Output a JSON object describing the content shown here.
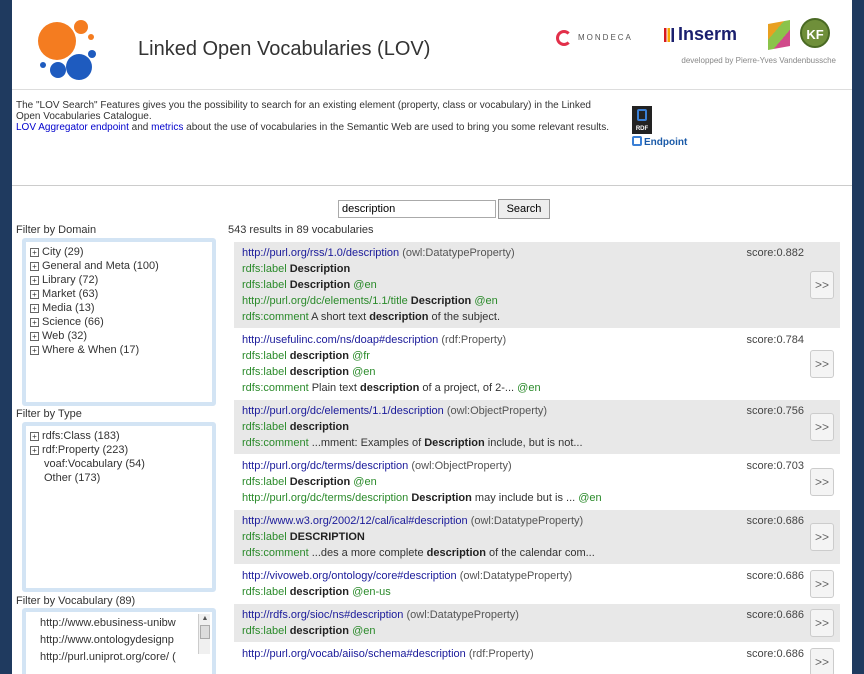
{
  "header": {
    "title": "Linked Open Vocabularies (LOV)",
    "partners": {
      "mondeca": "MONDECA",
      "inserm": "Inserm",
      "okf": "KF",
      "developped": "developped by Pierre-Yves Vandenbussche"
    },
    "logo_colors": [
      "#f47c20",
      "#1e5bbf"
    ]
  },
  "intro": {
    "line1": "The \"LOV Search\" Features gives you the possibility to search for an existing element (property, class or vocabulary) in the Linked Open Vocabularies Catalogue.",
    "link1": "LOV Aggregator endpoint",
    "and": " and ",
    "link2": "metrics",
    "line2": " about the use of vocabularies in the Semantic Web are used to bring you some relevant results.",
    "endpoint_label": "Endpoint",
    "rdf_label": "RDF"
  },
  "search": {
    "value": "description",
    "button": "Search",
    "results_count": "543 results in 89 vocabularies"
  },
  "filters": {
    "domain": {
      "heading": "Filter by Domain",
      "items": [
        "City (29)",
        "General and Meta (100)",
        "Library (72)",
        "Market (63)",
        "Media (13)",
        "Science (66)",
        "Web (32)",
        "Where & When (17)"
      ]
    },
    "type": {
      "heading": "Filter by Type",
      "expandable": [
        "rdfs:Class (183)",
        "rdf:Property (223)"
      ],
      "plain": [
        "voaf:Vocabulary (54)",
        "Other (173)"
      ]
    },
    "vocabulary": {
      "heading": "Filter by Vocabulary (89)",
      "items": [
        "http://www.ebusiness-unibw",
        "http://www.ontologydesignp",
        "http://purl.uniprot.org/core/ ("
      ]
    }
  },
  "results": [
    {
      "uri": "http://purl.org/rss/1.0/description",
      "type": "(owl:DatatypeProperty)",
      "score": "score:0.882",
      "lines": [
        {
          "prop": "rdfs:label",
          "value": "Description",
          "lang": ""
        },
        {
          "prop": "rdfs:label",
          "value": "Description",
          "lang": "@en"
        },
        {
          "uri": "http://purl.org/dc/elements/1.1/title",
          "value": "Description",
          "lang": "@en"
        },
        {
          "prop": "rdfs:comment",
          "pre": "A short text ",
          "value": "description",
          "post": " of the subject."
        }
      ]
    },
    {
      "uri": "http://usefulinc.com/ns/doap#description",
      "type": "(rdf:Property)",
      "score": "score:0.784",
      "lines": [
        {
          "prop": "rdfs:label",
          "value": "description",
          "lang": "@fr"
        },
        {
          "prop": "rdfs:label",
          "value": "description",
          "lang": "@en"
        },
        {
          "prop": "rdfs:comment",
          "pre": "Plain text ",
          "value": "description",
          "post": " of a project, of 2-...",
          "lang": "@en"
        }
      ]
    },
    {
      "uri": "http://purl.org/dc/elements/1.1/description",
      "type": "(owl:ObjectProperty)",
      "score": "score:0.756",
      "lines": [
        {
          "prop": "rdfs:label",
          "value": "description",
          "lang": ""
        },
        {
          "prop": "rdfs:comment",
          "pre": "...mment: Examples of ",
          "value": "Description",
          "post": " include, but is not..."
        }
      ]
    },
    {
      "uri": "http://purl.org/dc/terms/description",
      "type": "(owl:ObjectProperty)",
      "score": "score:0.703",
      "lines": [
        {
          "prop": "rdfs:label",
          "value": "Description",
          "lang": "@en"
        },
        {
          "uri": "http://purl.org/dc/terms/description",
          "value": "Description",
          "post": " may include but is ...",
          "lang": "@en"
        }
      ]
    },
    {
      "uri": "http://www.w3.org/2002/12/cal/ical#description",
      "type": "(owl:DatatypeProperty)",
      "score": "score:0.686",
      "lines": [
        {
          "prop": "rdfs:label",
          "value": "DESCRIPTION",
          "lang": ""
        },
        {
          "prop": "rdfs:comment",
          "pre": "...des a more complete ",
          "value": "description",
          "post": " of the calendar com..."
        }
      ]
    },
    {
      "uri": "http://vivoweb.org/ontology/core#description",
      "type": "(owl:DatatypeProperty)",
      "score": "score:0.686",
      "lines": [
        {
          "prop": "rdfs:label",
          "value": "description",
          "lang": "@en-us"
        }
      ]
    },
    {
      "uri": "http://rdfs.org/sioc/ns#description",
      "type": "(owl:DatatypeProperty)",
      "score": "score:0.686",
      "lines": [
        {
          "prop": "rdfs:label",
          "value": "description",
          "lang": "@en"
        }
      ]
    },
    {
      "uri": "http://purl.org/vocab/aiiso/schema#description",
      "type": "(rdf:Property)",
      "score": "score:0.686",
      "lines": []
    }
  ],
  "more_label": ">>"
}
